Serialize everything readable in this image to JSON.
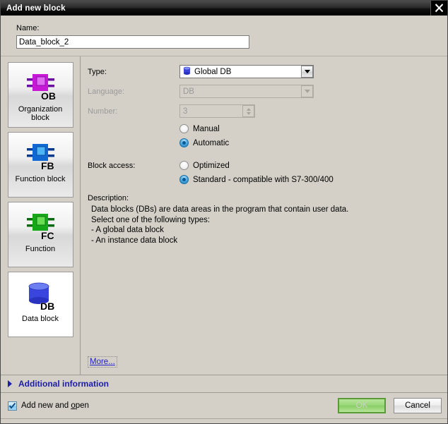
{
  "window": {
    "title": "Add new block",
    "close_icon": "close-icon"
  },
  "name_field": {
    "label": "Name:",
    "value": "Data_block_2"
  },
  "sidebar": {
    "items": [
      {
        "label": "Organization block",
        "icon": "ob-block-icon",
        "abbr": "OB",
        "selected": false
      },
      {
        "label": "Function block",
        "icon": "fb-block-icon",
        "abbr": "FB",
        "selected": false
      },
      {
        "label": "Function",
        "icon": "fc-block-icon",
        "abbr": "FC",
        "selected": false
      },
      {
        "label": "Data block",
        "icon": "db-cylinder-icon",
        "abbr": "DB",
        "selected": true
      }
    ]
  },
  "form": {
    "type": {
      "label": "Type:",
      "value": "Global DB",
      "icon": "db-cylinder-icon",
      "enabled": true
    },
    "language": {
      "label": "Language:",
      "value": "DB",
      "enabled": false
    },
    "number": {
      "label": "Number:",
      "value": "3",
      "enabled": false
    },
    "number_mode": {
      "options": [
        {
          "label": "Manual",
          "selected": false
        },
        {
          "label": "Automatic",
          "selected": true
        }
      ]
    },
    "block_access": {
      "label": "Block access:",
      "options": [
        {
          "label": "Optimized",
          "selected": false
        },
        {
          "label": "Standard - compatible with S7-300/400",
          "selected": true
        }
      ]
    },
    "description": {
      "label": "Description:",
      "text": "Data blocks (DBs) are data areas in the program that contain user data.\nSelect one of the following types:\n- A global data block\n- An instance data block",
      "more_link": "More..."
    }
  },
  "additional_information": {
    "label": "Additional  information",
    "expander_icon": "triangle-right-icon",
    "expanded": false
  },
  "footer": {
    "checkbox": {
      "label_before": "Add new and ",
      "label_accel": "o",
      "label_after": "pen",
      "checked": true
    },
    "ok_label": "OK",
    "cancel_label": "Cancel"
  },
  "colors": {
    "accent_blue": "#1c1cae",
    "ok_green": "#8ace66",
    "link_blue": "#2121c8",
    "dialog_bg": "#d4d0c8",
    "titlebar_black": "#000000"
  }
}
